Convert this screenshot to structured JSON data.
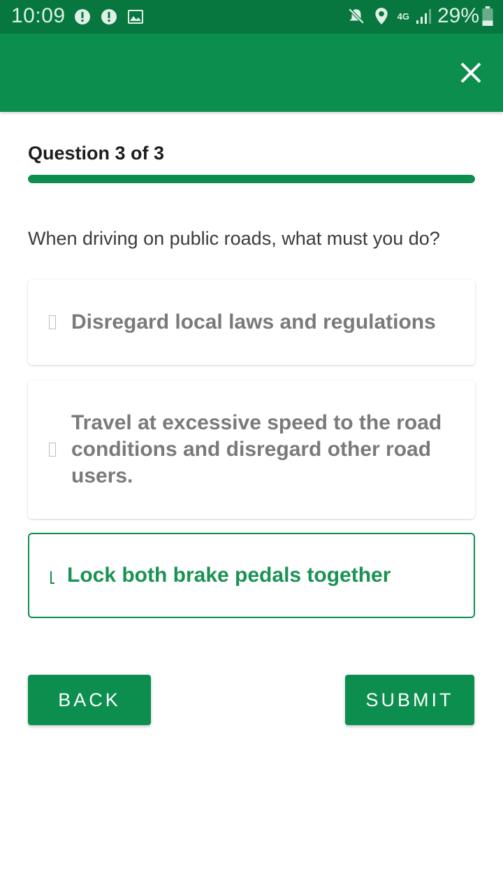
{
  "status_bar": {
    "time": "10:09",
    "network": "4G",
    "battery": "29%",
    "icons": [
      "alert-icon",
      "alert-icon",
      "image-icon",
      "mute-icon",
      "location-icon",
      "network-4g-icon",
      "signal-icon",
      "battery-icon"
    ]
  },
  "app_bar": {
    "close_icon": "close-icon"
  },
  "quiz": {
    "counter": "Question 3 of 3",
    "progress": 1.0,
    "question": "When driving on public roads, what must you do?",
    "options": [
      {
        "label": "Disregard local laws and regulations",
        "selected": false
      },
      {
        "label": "Travel at excessive speed to the road conditions and disregard other road users.",
        "selected": false
      },
      {
        "label": "Lock both brake pedals together",
        "selected": true
      }
    ]
  },
  "buttons": {
    "back": "BACK",
    "submit": "SUBMIT"
  },
  "colors": {
    "primary": "#0c8e4e",
    "status_bar": "#07773f",
    "selected_text": "#1a9255"
  }
}
